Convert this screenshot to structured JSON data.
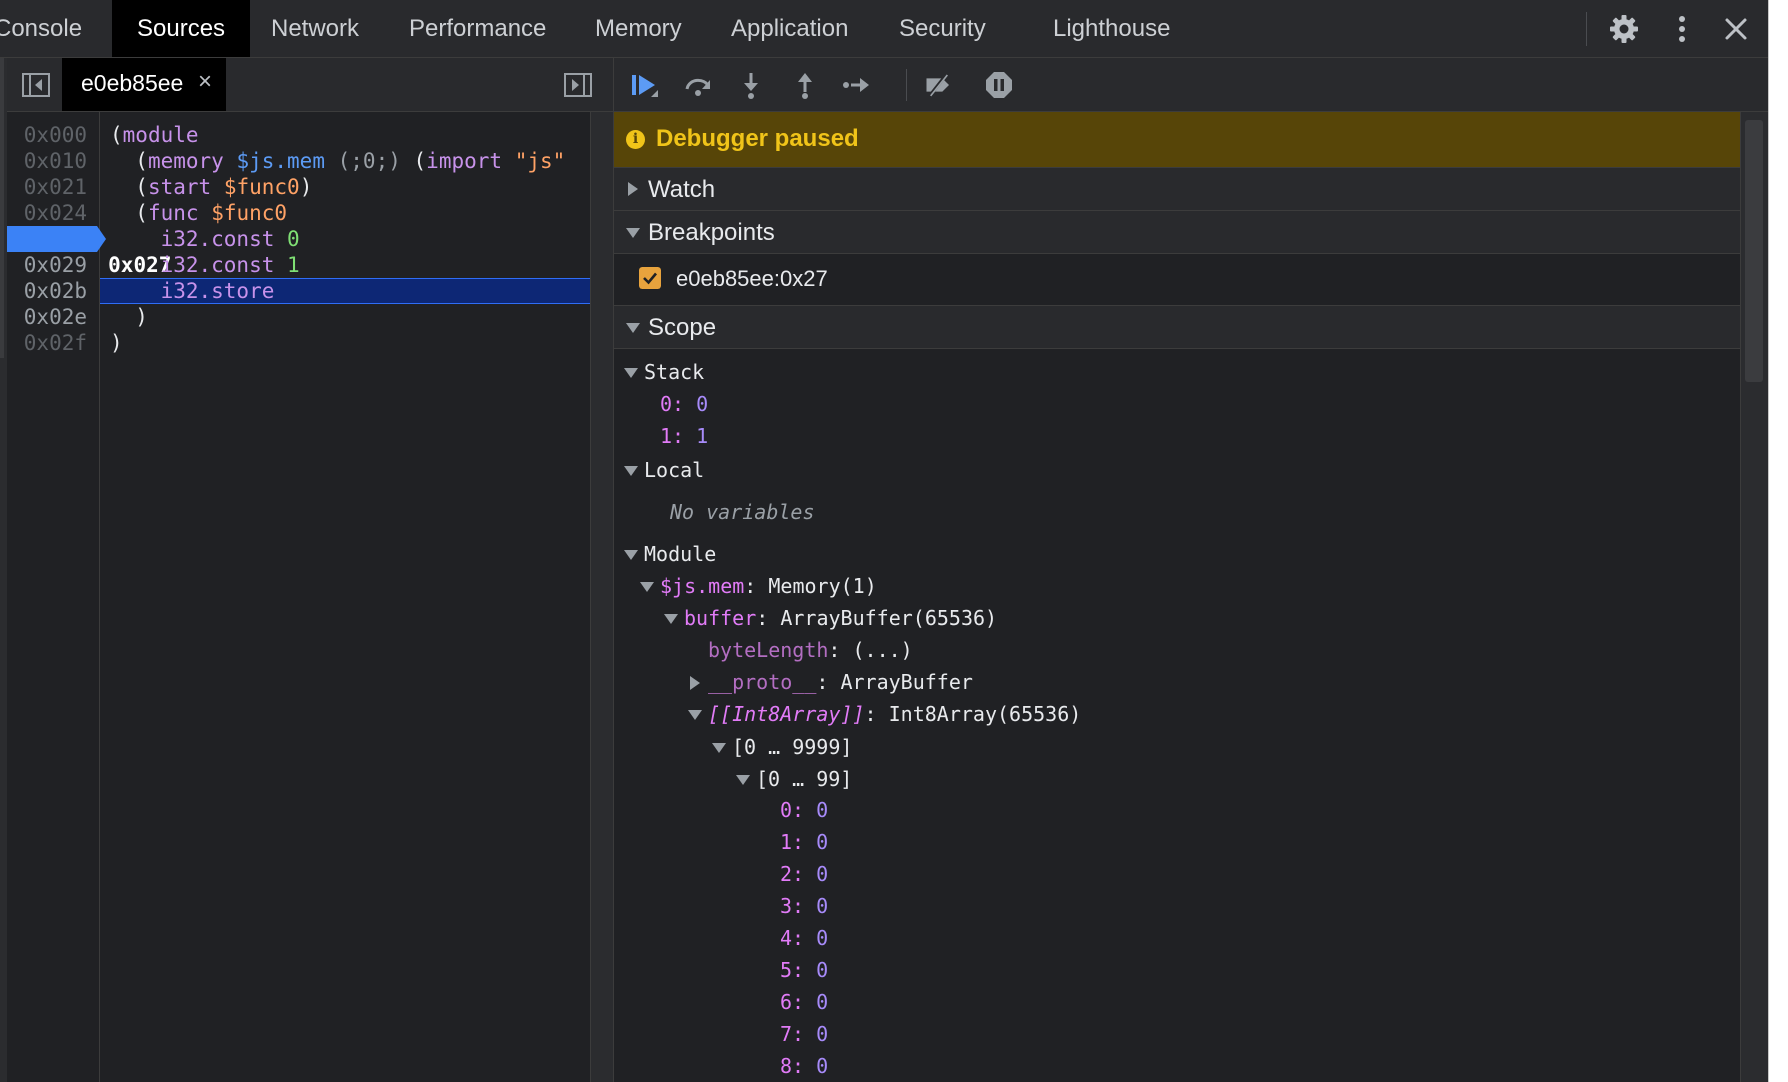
{
  "tabs": [
    "Console",
    "Sources",
    "Network",
    "Performance",
    "Memory",
    "Application",
    "Security",
    "Lighthouse"
  ],
  "active_tab": "Sources",
  "top_icons": [
    "settings-gear-icon",
    "more-vert-icon",
    "close-icon"
  ],
  "editor": {
    "file_tab": "e0eb85ee",
    "close_glyph": "×",
    "line_numbers": [
      "0x000",
      "0x010",
      "0x021",
      "0x024",
      "0x027",
      "0x029",
      "0x02b",
      "0x02e",
      "0x02f"
    ],
    "active_line": "0x027",
    "code": {
      "l0_open": "(",
      "l0_module": "module",
      "l1_open": "(",
      "l1_memory": "memory",
      "l1_id": "$js.mem",
      "l1_comment": "(;0;)",
      "l1_open2": "(",
      "l1_import": "import",
      "l1_str": "\"js\"",
      "l2_open": "(",
      "l2_start": "start",
      "l2_id": "$func0",
      "l2_close": ")",
      "l3_open": "(",
      "l3_func": "func",
      "l3_id": "$func0",
      "l4_instr": "i32.const",
      "l4_num": "0",
      "l5_instr": "i32.const",
      "l5_num": "1",
      "l6_instr": "i32.store",
      "l7_close": ")",
      "l8_close": ")"
    }
  },
  "debugger": {
    "toolbar_icons": [
      "resume-icon",
      "step-over-icon",
      "step-into-icon",
      "step-out-icon",
      "step-icon",
      "deactivate-breakpoints-icon",
      "pause-on-exceptions-icon"
    ],
    "paused_icon": "i",
    "paused_text": "Debugger paused",
    "sections": {
      "watch": "Watch",
      "breakpoints": "Breakpoints",
      "scope": "Scope"
    },
    "breakpoint": "e0eb85ee:0x27",
    "scope": {
      "stack_label": "Stack",
      "stack": [
        {
          "key": "0",
          "value": "0"
        },
        {
          "key": "1",
          "value": "1"
        }
      ],
      "local_label": "Local",
      "no_variables": "No variables",
      "module_label": "Module",
      "jsmem_key": "$js.mem",
      "jsmem_value": "Memory(1)",
      "buffer_key": "buffer",
      "buffer_value": "ArrayBuffer(65536)",
      "bytelength_key": "byteLength",
      "bytelength_value": "(...)",
      "proto_key": "__proto__",
      "proto_value": "ArrayBuffer",
      "int8_key": "[[Int8Array]]",
      "int8_value": "Int8Array(65536)",
      "range_outer": "[0 … 9999]",
      "range_inner": "[0 … 99]",
      "elements": [
        {
          "key": "0",
          "value": "0"
        },
        {
          "key": "1",
          "value": "0"
        },
        {
          "key": "2",
          "value": "0"
        },
        {
          "key": "3",
          "value": "0"
        },
        {
          "key": "4",
          "value": "0"
        },
        {
          "key": "5",
          "value": "0"
        },
        {
          "key": "6",
          "value": "0"
        },
        {
          "key": "7",
          "value": "0"
        },
        {
          "key": "8",
          "value": "0"
        }
      ]
    }
  }
}
